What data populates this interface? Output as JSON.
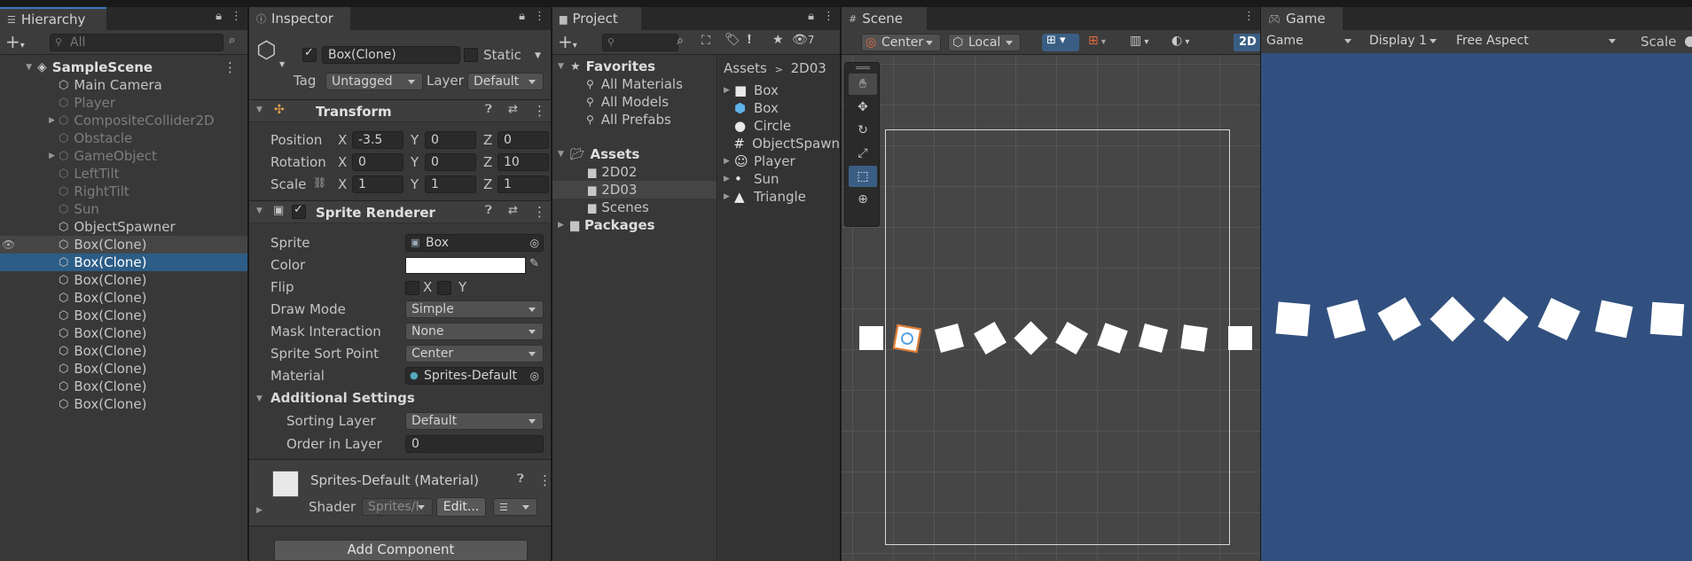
{
  "hierarchy": {
    "tab": "Hierarchy",
    "search_placeholder": "All",
    "scene_name": "SampleScene",
    "items": [
      {
        "label": "Main Camera",
        "dim": false,
        "expandable": false
      },
      {
        "label": "Player",
        "dim": true,
        "expandable": false
      },
      {
        "label": "CompositeCollider2D",
        "dim": true,
        "expandable": true
      },
      {
        "label": "Obstacle",
        "dim": true,
        "expandable": false
      },
      {
        "label": "GameObject",
        "dim": true,
        "expandable": true
      },
      {
        "label": "LeftTilt",
        "dim": true,
        "expandable": false
      },
      {
        "label": "RightTilt",
        "dim": true,
        "expandable": false
      },
      {
        "label": "Sun",
        "dim": true,
        "expandable": false
      },
      {
        "label": "ObjectSpawner",
        "dim": false,
        "expandable": false
      },
      {
        "label": "Box(Clone)",
        "dim": false,
        "expandable": false
      },
      {
        "label": "Box(Clone)",
        "dim": false,
        "expandable": false
      },
      {
        "label": "Box(Clone)",
        "dim": false,
        "expandable": false
      },
      {
        "label": "Box(Clone)",
        "dim": false,
        "expandable": false
      },
      {
        "label": "Box(Clone)",
        "dim": false,
        "expandable": false
      },
      {
        "label": "Box(Clone)",
        "dim": false,
        "expandable": false
      },
      {
        "label": "Box(Clone)",
        "dim": false,
        "expandable": false
      },
      {
        "label": "Box(Clone)",
        "dim": false,
        "expandable": false
      },
      {
        "label": "Box(Clone)",
        "dim": false,
        "expandable": false
      },
      {
        "label": "Box(Clone)",
        "dim": false,
        "expandable": false
      }
    ]
  },
  "inspector": {
    "tab": "Inspector",
    "object_name": "Box(Clone)",
    "static_label": "Static",
    "tag_label": "Tag",
    "tag_value": "Untagged",
    "layer_label": "Layer",
    "layer_value": "Default",
    "transform": {
      "title": "Transform",
      "position_label": "Position",
      "rotation_label": "Rotation",
      "scale_label": "Scale",
      "pos": {
        "x": "-3.5",
        "y": "0",
        "z": "0"
      },
      "rot": {
        "x": "0",
        "y": "0",
        "z": "10"
      },
      "scl": {
        "x": "1",
        "y": "1",
        "z": "1"
      },
      "x": "X",
      "y": "Y",
      "z": "Z"
    },
    "sprite_renderer": {
      "title": "Sprite Renderer",
      "sprite_label": "Sprite",
      "sprite_value": "Box",
      "color_label": "Color",
      "flip_label": "Flip",
      "flip_x": "X",
      "flip_y": "Y",
      "draw_mode_label": "Draw Mode",
      "draw_mode_value": "Simple",
      "mask_label": "Mask Interaction",
      "mask_value": "None",
      "sort_point_label": "Sprite Sort Point",
      "sort_point_value": "Center",
      "material_label": "Material",
      "material_value": "Sprites-Default",
      "additional_label": "Additional Settings",
      "sorting_layer_label": "Sorting Layer",
      "sorting_layer_value": "Default",
      "order_label": "Order in Layer",
      "order_value": "0"
    },
    "material": {
      "title": "Sprites-Default (Material)",
      "shader_label": "Shader",
      "shader_value": "Sprites/I",
      "edit_label": "Edit..."
    },
    "add_component": "Add Component"
  },
  "project": {
    "tab": "Project",
    "favorites_label": "Favorites",
    "favorites": [
      "All Materials",
      "All Models",
      "All Prefabs"
    ],
    "assets_label": "Assets",
    "asset_folders": [
      "2D02",
      "2D03",
      "Scenes"
    ],
    "packages_label": "Packages",
    "breadcrumb": [
      "Assets",
      "2D03"
    ],
    "files": [
      {
        "label": "Box",
        "icon": "sprite-square-icon"
      },
      {
        "label": "Box",
        "icon": "prefab-cube-icon"
      },
      {
        "label": "Circle",
        "icon": "sprite-circle-icon"
      },
      {
        "label": "ObjectSpawn",
        "icon": "script-icon"
      },
      {
        "label": "Player",
        "icon": "player-sprite-icon"
      },
      {
        "label": "Sun",
        "icon": "sun-sprite-icon"
      },
      {
        "label": "Triangle",
        "icon": "sprite-triangle-icon"
      }
    ],
    "hidden_count": "7"
  },
  "scene": {
    "tab": "Scene",
    "pivot": "Center",
    "space": "Local",
    "mode_2d": "2D"
  },
  "game": {
    "tab": "Game",
    "view": "Game",
    "display": "Display 1",
    "aspect": "Free Aspect",
    "scale_label": "Scale"
  },
  "colors": {
    "selection": "#2c5d87",
    "game_bg": "#31507f",
    "scene_bg": "#464646"
  }
}
